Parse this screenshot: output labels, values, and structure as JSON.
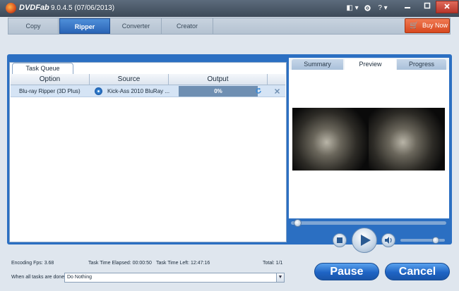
{
  "app": {
    "brand": "DVDFab",
    "version": "9.0.4.5 (07/06/2013)"
  },
  "titlebar": {
    "icons": [
      "layout-icon",
      "gear-icon",
      "help-icon",
      "minimize-icon",
      "maximize-icon",
      "close-icon"
    ],
    "help_label": "? ▾",
    "layout_label": "◧ ▾"
  },
  "tabs": [
    {
      "label": "Copy"
    },
    {
      "label": "Ripper"
    },
    {
      "label": "Converter"
    },
    {
      "label": "Creator"
    }
  ],
  "buy_now": "Buy Now",
  "task_queue": {
    "tab_label": "Task Queue",
    "columns": [
      "Option",
      "Source",
      "Output"
    ],
    "rows": [
      {
        "option": "Blu-ray Ripper (3D Plus)",
        "source": "Kick-Ass 2010 BluRay ...",
        "output": "0%",
        "progress": 0
      }
    ]
  },
  "right_tabs": [
    {
      "label": "Summary"
    },
    {
      "label": "Preview"
    },
    {
      "label": "Progress"
    }
  ],
  "player": {
    "seek_position": 0.04,
    "volume": 0.8
  },
  "status": {
    "encoding_fps": "Encoding Fps: 3.68",
    "elapsed": "Task Time Elapsed: 00:00:50",
    "left": "Task Time Left: 12:47:16",
    "total": "Total: 1/1"
  },
  "when_done": {
    "label": "When all tasks are done:",
    "value": "Do Nothing"
  },
  "buttons": {
    "pause": "Pause",
    "cancel": "Cancel"
  },
  "colors": {
    "accent": "#2b6fc2",
    "buy": "#e2542a",
    "title": "#4a5867"
  }
}
